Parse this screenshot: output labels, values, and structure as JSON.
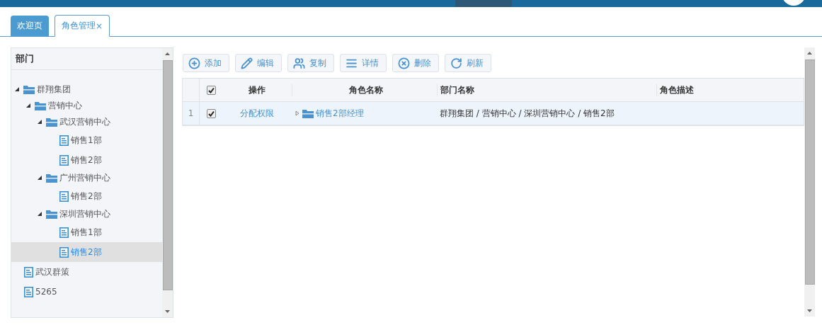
{
  "tabs": [
    {
      "label": "欢迎页",
      "selected": false
    },
    {
      "label": "角色管理",
      "selected": true,
      "close_glyph": "×"
    }
  ],
  "sidebar": {
    "title": "部门",
    "tree": [
      {
        "label": "群翔集团",
        "expanded": true,
        "selected": false,
        "children": [
          {
            "label": "营销中心",
            "expanded": true,
            "selected": false,
            "children": [
              {
                "label": "武汉营销中心",
                "expanded": true,
                "selected": false,
                "children": [
                  {
                    "label": "销售1部",
                    "selected": false
                  },
                  {
                    "label": "销售2部",
                    "selected": false
                  }
                ]
              },
              {
                "label": "广州营销中心",
                "expanded": true,
                "selected": false,
                "children": [
                  {
                    "label": "销售2部",
                    "selected": false
                  }
                ]
              },
              {
                "label": "深圳营销中心",
                "expanded": true,
                "selected": false,
                "children": [
                  {
                    "label": "销售1部",
                    "selected": false
                  },
                  {
                    "label": "销售2部",
                    "selected": true
                  }
                ]
              }
            ]
          }
        ]
      },
      {
        "label": "武汉群策",
        "selected": false
      },
      {
        "label": "5265",
        "selected": false
      }
    ]
  },
  "toolbar": [
    {
      "kind": "add",
      "label": "添加"
    },
    {
      "kind": "edit",
      "label": "编辑"
    },
    {
      "kind": "copy",
      "label": "复制"
    },
    {
      "kind": "detail",
      "label": "详情"
    },
    {
      "kind": "delete",
      "label": "删除"
    },
    {
      "kind": "refresh",
      "label": "刷新"
    }
  ],
  "table": {
    "all_checked": true,
    "columns": [
      "操作",
      "角色名称",
      "部门名称",
      "角色描述"
    ],
    "rows": [
      {
        "index": "1",
        "checked": true,
        "selected": true,
        "action": "分配权限",
        "role": "销售2部经理",
        "expanded": false,
        "department": "群翔集团 / 营销中心 / 深圳营销中心 / 销售2部"
      }
    ]
  }
}
